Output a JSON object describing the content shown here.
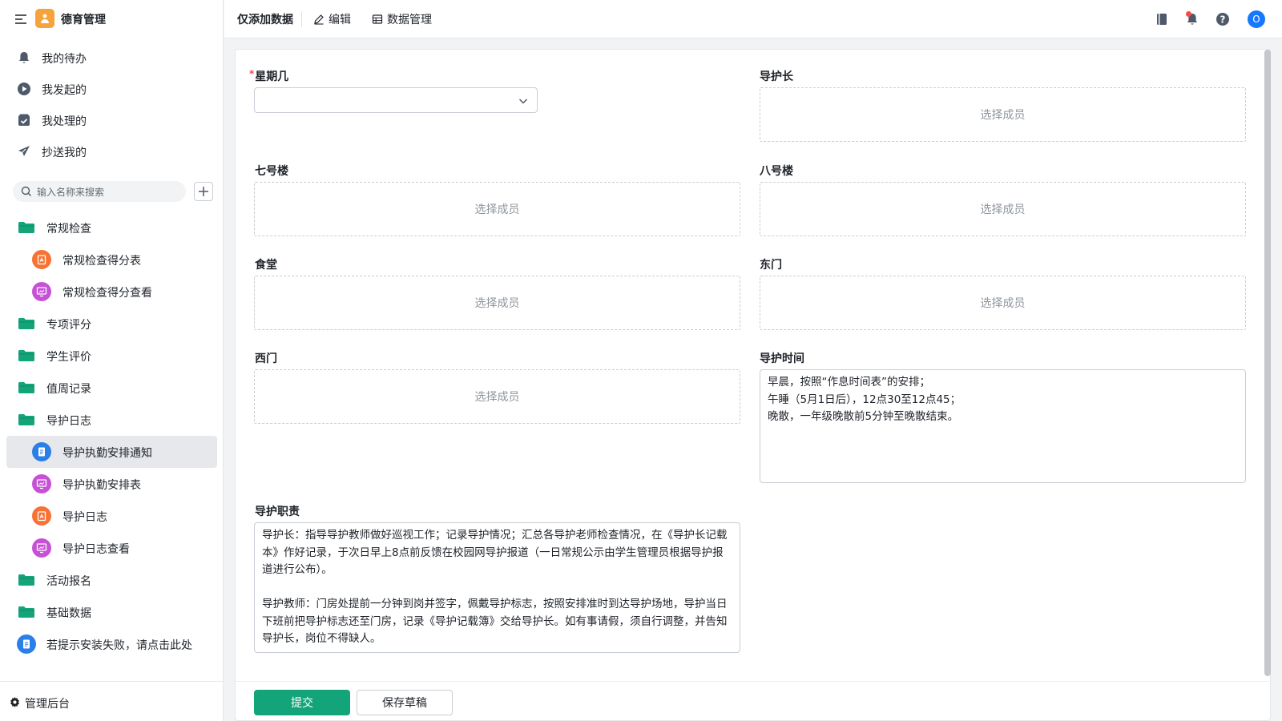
{
  "app": {
    "title": "德育管理"
  },
  "quick_nav": [
    {
      "label": "我的待办",
      "icon": "bell-icon"
    },
    {
      "label": "我发起的",
      "icon": "play-circle-icon"
    },
    {
      "label": "我处理的",
      "icon": "check-box-icon"
    },
    {
      "label": "抄送我的",
      "icon": "send-icon"
    }
  ],
  "search": {
    "placeholder": "输入名称来搜索"
  },
  "nav": [
    {
      "label": "常规检查",
      "kind": "folder",
      "icon": "folder-icon"
    },
    {
      "label": "常规检查得分表",
      "kind": "app",
      "icon": "form-app-icon",
      "color": "#f77234"
    },
    {
      "label": "常规检查得分查看",
      "kind": "app",
      "icon": "report-app-icon",
      "color": "#c751d6"
    },
    {
      "label": "专项评分",
      "kind": "folder",
      "icon": "folder-icon"
    },
    {
      "label": "学生评价",
      "kind": "folder",
      "icon": "folder-icon"
    },
    {
      "label": "值周记录",
      "kind": "folder",
      "icon": "folder-icon"
    },
    {
      "label": "导护日志",
      "kind": "folder",
      "icon": "folder-icon"
    },
    {
      "label": "导护执勤安排通知",
      "kind": "app",
      "icon": "document-app-icon",
      "color": "#2b7fe8",
      "active": true
    },
    {
      "label": "导护执勤安排表",
      "kind": "app",
      "icon": "report-app-icon",
      "color": "#c751d6"
    },
    {
      "label": "导护日志",
      "kind": "app",
      "icon": "form-app-icon",
      "color": "#f77234"
    },
    {
      "label": "导护日志查看",
      "kind": "app",
      "icon": "report-app-icon",
      "color": "#c751d6"
    },
    {
      "label": "活动报名",
      "kind": "folder",
      "icon": "folder-icon"
    },
    {
      "label": "基础数据",
      "kind": "folder",
      "icon": "folder-icon"
    },
    {
      "label": "若提示安装失败，请点击此处",
      "kind": "app",
      "icon": "document-app-icon",
      "color": "#2b7fe8"
    }
  ],
  "admin": {
    "label": "管理后台"
  },
  "header": {
    "title": "仅添加数据",
    "edit_label": "编辑",
    "data_mgmt_label": "数据管理",
    "avatar_initial": "O"
  },
  "form": {
    "weekday_label": "星期几",
    "weekday_value": "",
    "member_placeholder": "选择成员",
    "fields": {
      "leader": "导护长",
      "building7": "七号楼",
      "building8": "八号楼",
      "canteen": "食堂",
      "east_gate": "东门",
      "west_gate": "西门",
      "time": "导护时间",
      "duty": "导护职责"
    },
    "time_lines": [
      "早晨，按照“作息时间表”的安排；",
      "午睡（5月1日后），12点30至12点45；",
      "晚散，一年级晚散前5分钟至晚散结束。"
    ],
    "duty_paragraphs": [
      "导护长：指导导护教师做好巡视工作；记录导护情况；汇总各导护老师检查情况，在《导护长记载本》作好记录，于次日早上8点前反馈在校园网导护报道（一日常规公示由学生管理员根据导护报道进行公布）。",
      "导护教师：门房处提前一分钟到岗并签字，佩戴导护标志，按照安排准时到达导护场地，导护当日下班前把导护标志还至门房，记录《导护记载簿》交给导护长。如有事请假，须自行调整，并告知导护长，岗位不得缺人。"
    ],
    "submit_label": "提交",
    "draft_label": "保存草稿"
  },
  "colors": {
    "primary": "#14a47a",
    "folder": "#14a47a",
    "accent_blue": "#1677ff"
  }
}
